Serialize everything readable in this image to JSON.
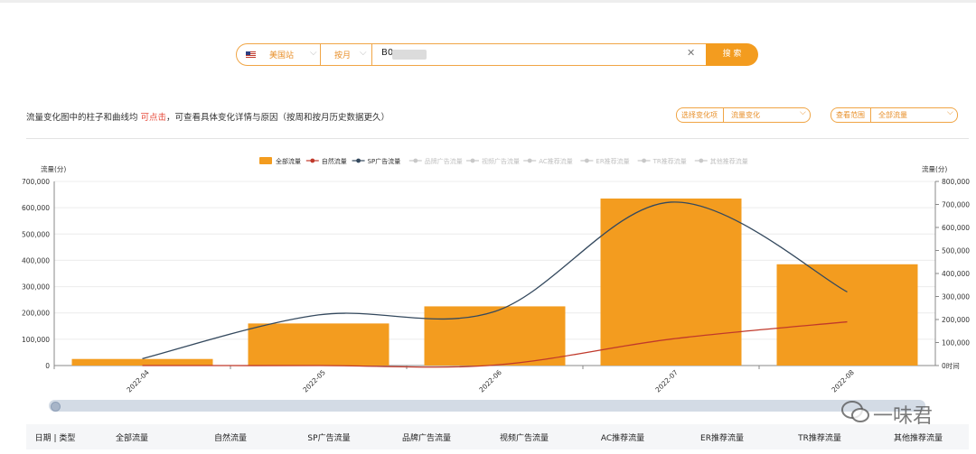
{
  "search": {
    "site": "美国站",
    "mode": "按月",
    "asin": "B0",
    "button": "搜 索"
  },
  "hint": {
    "before": "流量变化图中的柱子和曲线均 ",
    "highlight": "可点击",
    "after": "，可查看具体变化详情与原因（按周和按月历史数据更久）"
  },
  "filters": {
    "change_type": {
      "label": "选择变化项",
      "value": "流量变化"
    },
    "scope": {
      "label": "查看范围",
      "value": "全部流量"
    }
  },
  "chart_data": {
    "type": "bar",
    "categories": [
      "2022-04",
      "2022-05",
      "2022-06",
      "2022-07",
      "2022-08"
    ],
    "series": [
      {
        "name": "全部流量",
        "type": "bar",
        "axis": "left",
        "color": "#f39c1f",
        "values": [
          25000,
          160000,
          225000,
          635000,
          385000
        ]
      },
      {
        "name": "自然流量",
        "type": "line",
        "axis": "right",
        "color": "#c0392b",
        "values": [
          0,
          0,
          2000,
          115000,
          190000
        ]
      },
      {
        "name": "SP广告流量",
        "type": "line",
        "axis": "right",
        "color": "#34495e",
        "values": [
          30000,
          220000,
          235000,
          710000,
          320000
        ]
      }
    ],
    "legend": [
      "全部流量",
      "自然流量",
      "SP广告流量",
      "品牌广告流量",
      "视频广告流量",
      "AC推荐流量",
      "ER推荐流量",
      "TR推荐流量",
      "其他推荐流量"
    ],
    "legend_inactive_color": "#c8c8c8",
    "left_axis": {
      "label": "流量(分)",
      "ticks": [
        "0",
        "100,000",
        "200,000",
        "300,000",
        "400,000",
        "500,000",
        "600,000",
        "700,000"
      ],
      "ylim": [
        0,
        700000
      ]
    },
    "right_axis": {
      "label": "流量(分)",
      "ticks": [
        "0时间",
        "100,000",
        "200,000",
        "300,000",
        "400,000",
        "500,000",
        "600,000",
        "700,000",
        "800,000"
      ],
      "ylim": [
        0,
        800000
      ]
    }
  },
  "table": {
    "headers": [
      "日期 | 类型",
      "全部流量",
      "自然流量",
      "SP广告流量",
      "品牌广告流量",
      "视频广告流量",
      "AC推荐流量",
      "ER推荐流量",
      "TR推荐流量",
      "其他推荐流量"
    ]
  },
  "watermark": "一味君",
  "colors": {
    "accent": "#f39c1f"
  }
}
